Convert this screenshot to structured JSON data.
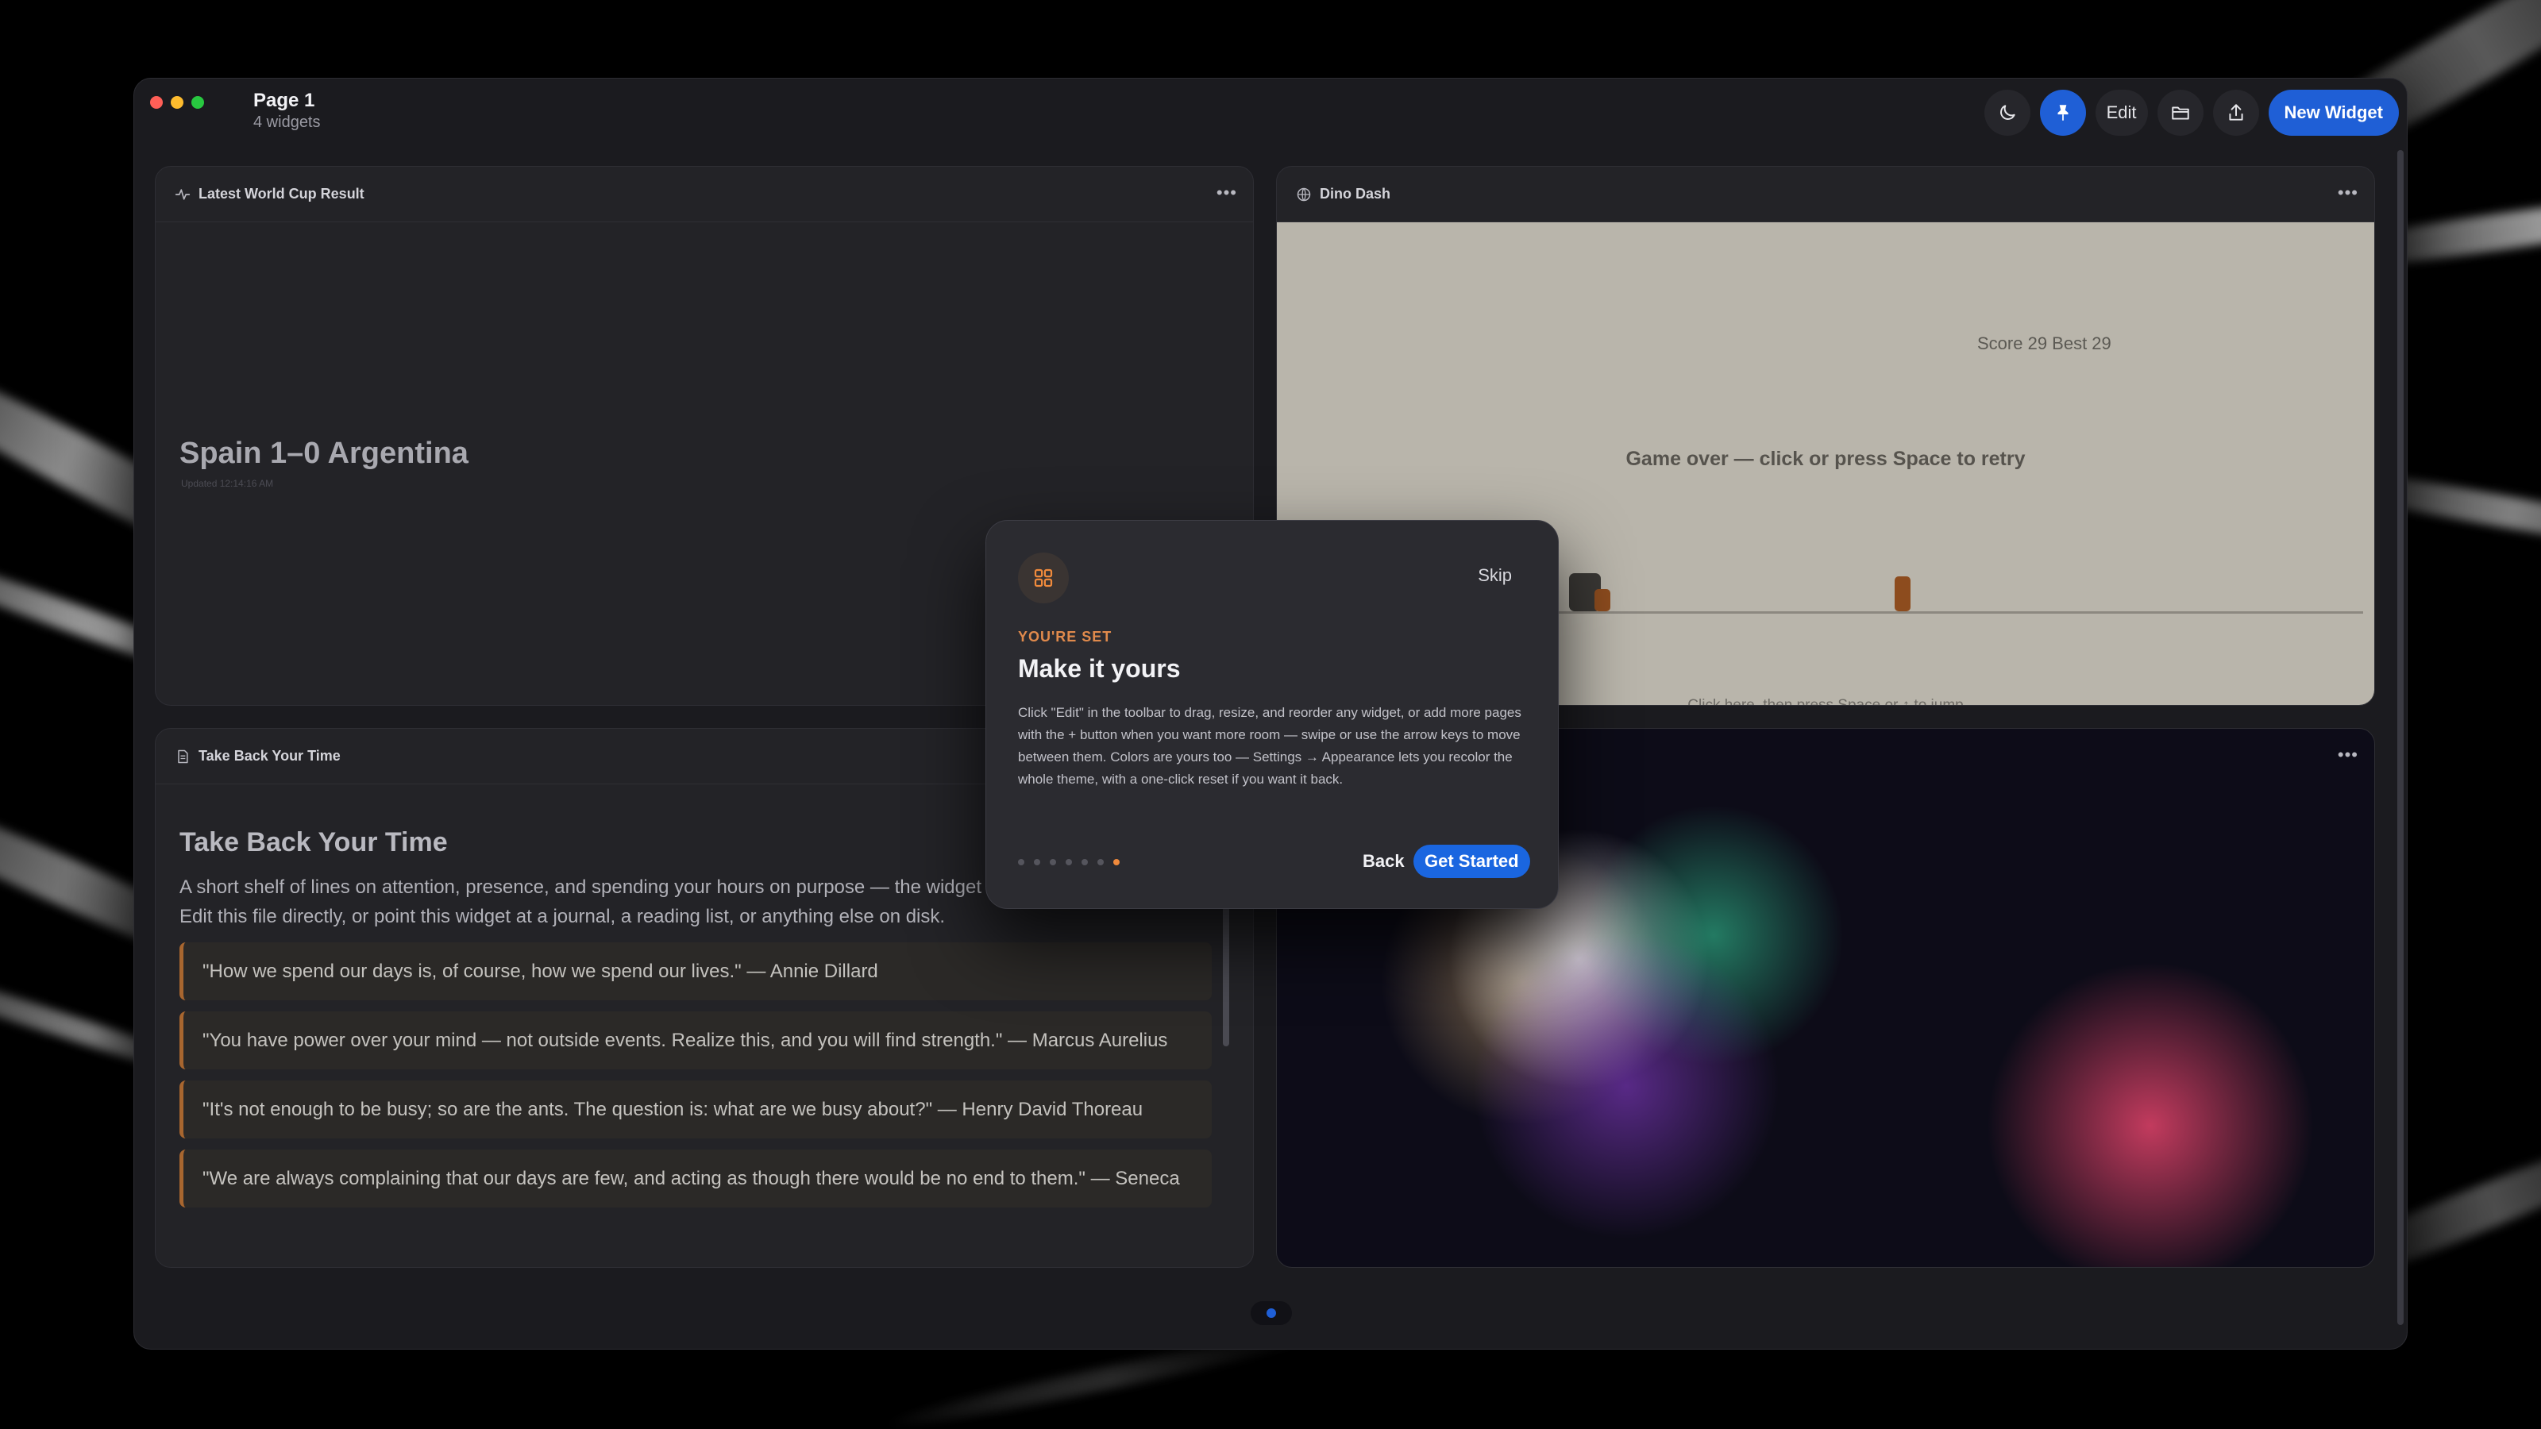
{
  "window": {
    "title": "Page 1",
    "subtitle": "4 widgets"
  },
  "toolbar": {
    "theme_icon": "moon-icon",
    "pin_icon": "pin-icon",
    "edit_label": "Edit",
    "folder_icon": "folder-icon",
    "share_icon": "share-icon",
    "new_widget_label": "New Widget",
    "accent": "#1f5fd6"
  },
  "widgets": {
    "cup": {
      "title": "Latest World Cup Result",
      "icon": "activity-icon",
      "score": "Spain 1–0 Argentina",
      "updated": "Updated 12:14:16 AM"
    },
    "dino": {
      "title": "Dino Dash",
      "icon": "globe-icon",
      "score": "Score 29   Best 29",
      "status": "Game over — click or press Space to retry",
      "hint": "Click here, then press Space or ↑ to jump"
    },
    "time": {
      "title": "Take Back Your Time",
      "icon": "document-icon",
      "heading": "Take Back Your Time",
      "intro": "A short shelf of lines on attention, presence, and spending your hours on purpose — the widget renders this file if it exists. Edit this file directly, or point this widget at a journal, a reading list, or anything else on disk.",
      "quotes": [
        "\"How we spend our days is, of course, how we spend our lives.\" — Annie Dillard",
        "\"You have power over your mind — not outside events. Realize this, and you will find strength.\" — Marcus Aurelius",
        "\"It's not enough to be busy; so are the ants. The question is: what are we busy about?\" — Henry David Thoreau",
        "\"We are always complaining that our days are few, and acting as though there would be no end to them.\" — Seneca"
      ]
    },
    "orbs": {
      "colors": [
        "#e8e8ee",
        "#2fb58a",
        "#8a3dd0",
        "#e2436a",
        "#d8b27a"
      ]
    }
  },
  "pager": {
    "pages": 1,
    "current": 1
  },
  "onboarding": {
    "icon": "widgets-grid-icon",
    "skip_label": "Skip",
    "eyebrow": "YOU'RE SET",
    "title": "Make it yours",
    "body": "Click \"Edit\" in the toolbar to drag, resize, and reorder any widget, or add more pages with the + button when you want more room — swipe or use the arrow keys to move between them. Colors are yours too — Settings → Appearance lets you recolor the whole theme, with a one-click reset if you want it back.",
    "step_total": 7,
    "step_current": 7,
    "back_label": "Back",
    "start_label": "Get Started",
    "accent": "#1a66e0",
    "eyebrow_color": "#e08a4c"
  }
}
